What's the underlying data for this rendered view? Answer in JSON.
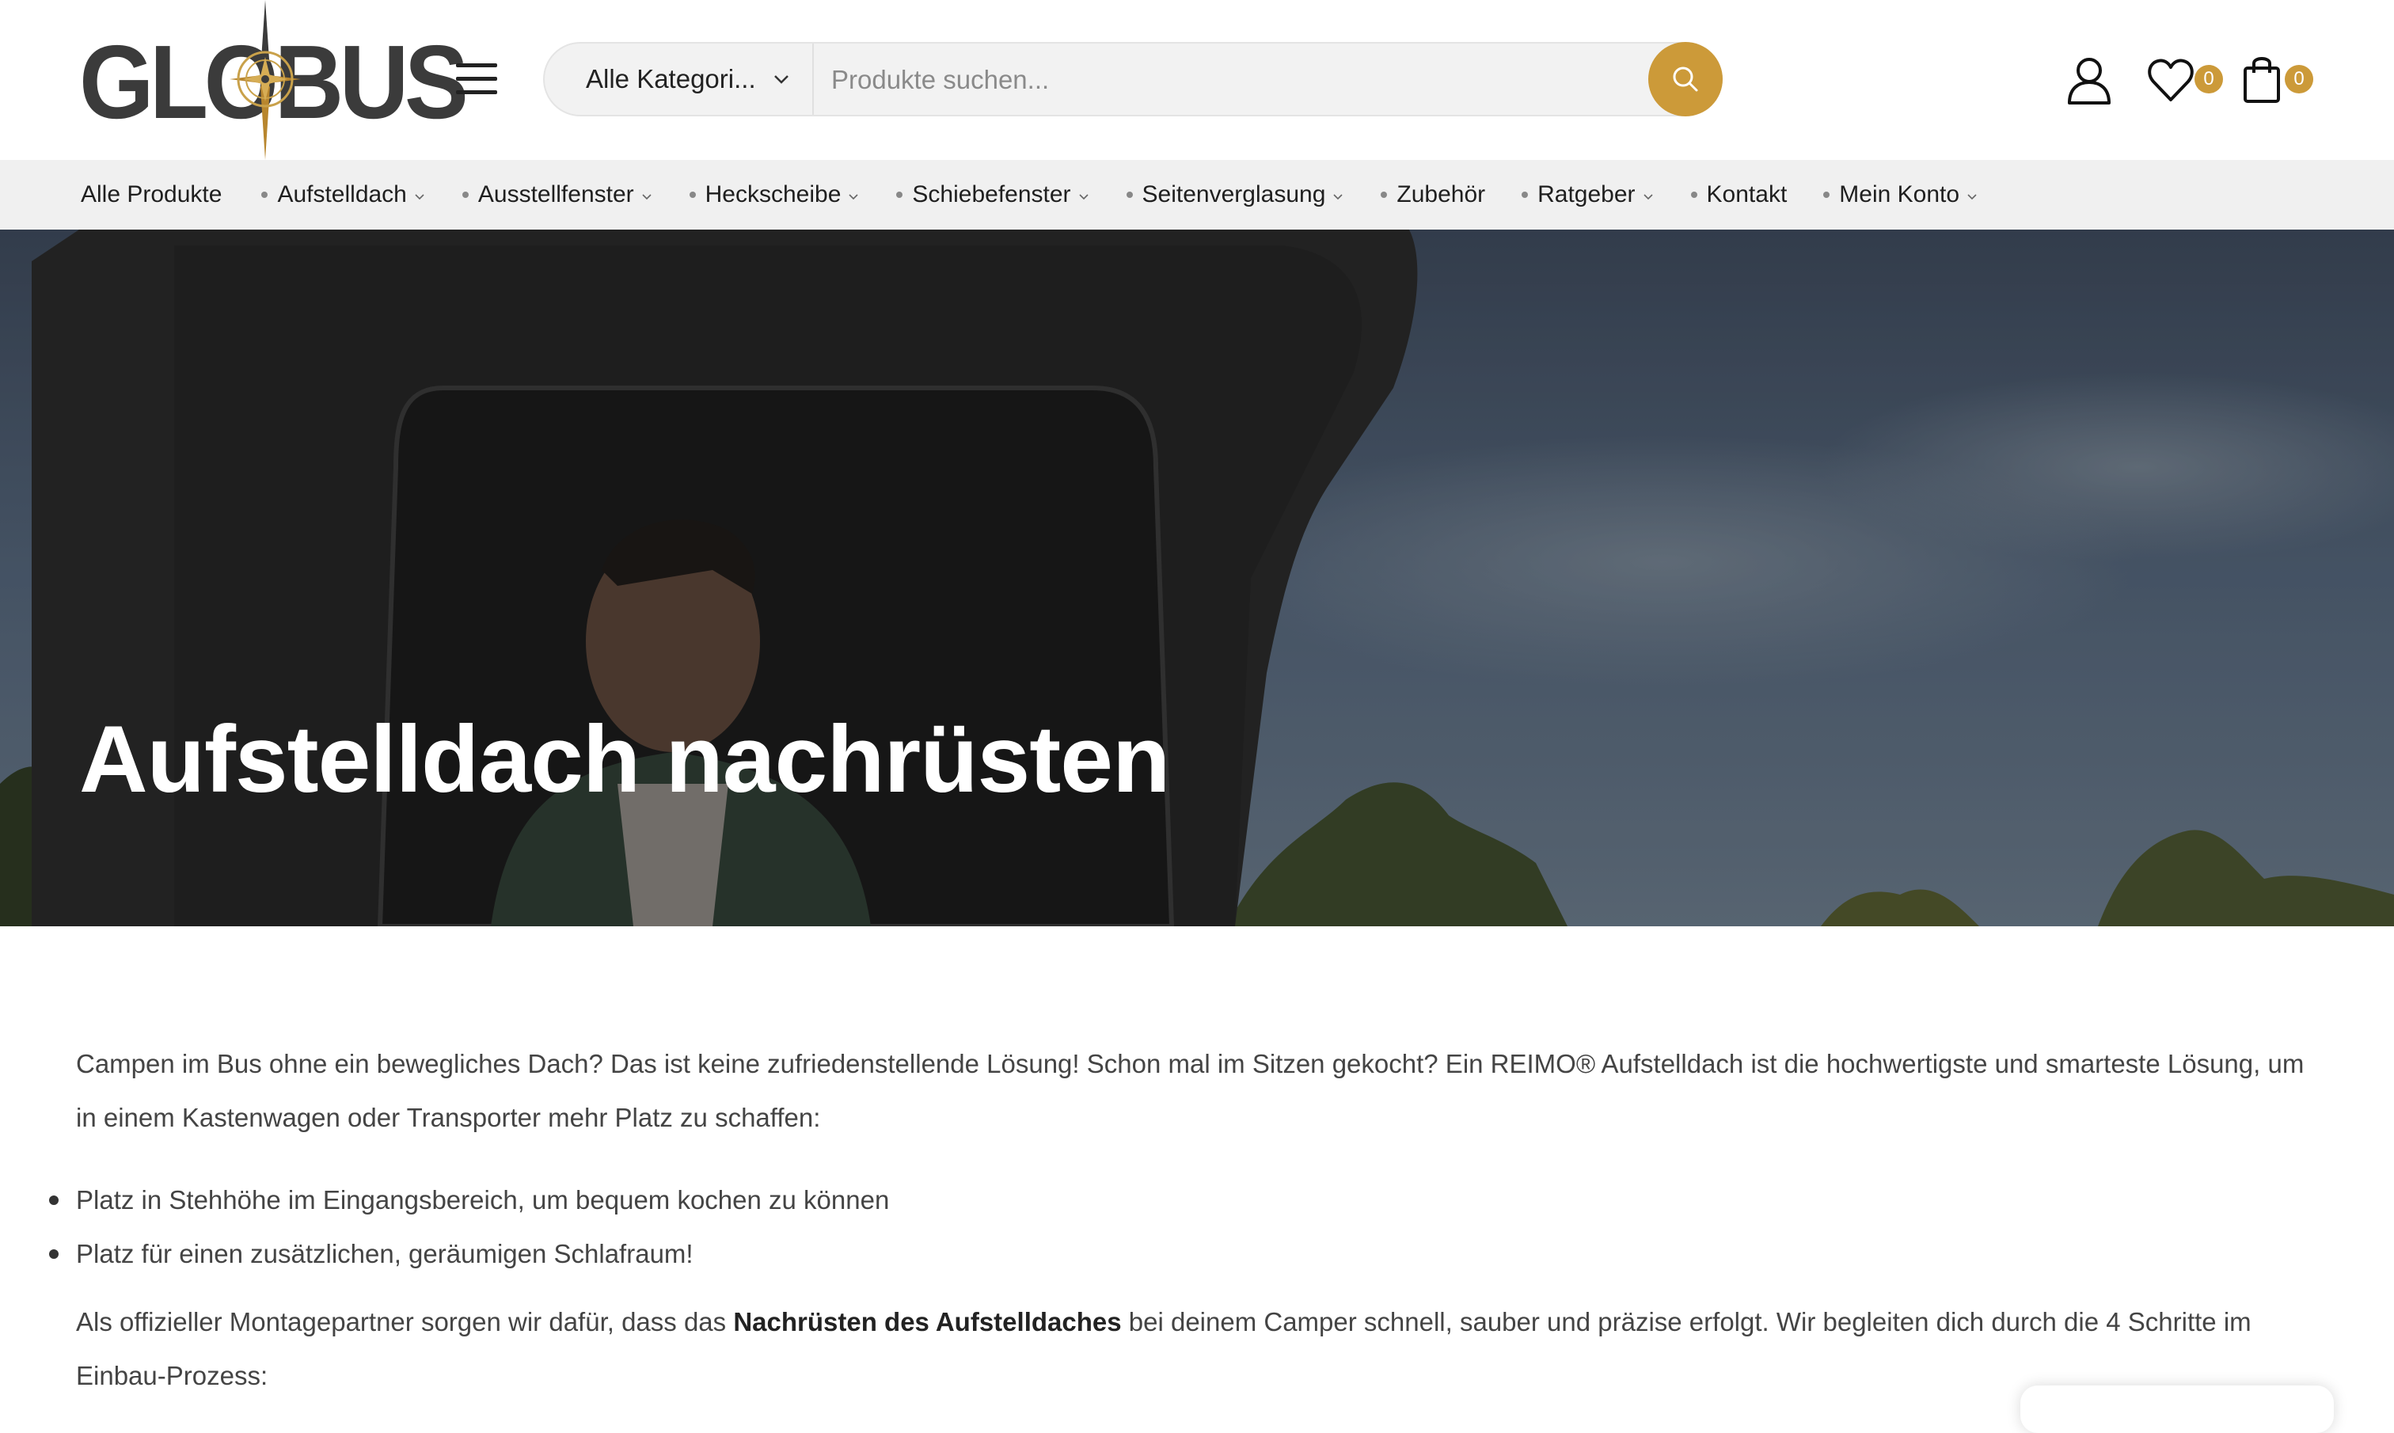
{
  "header": {
    "logo_text": "GLOBUS",
    "search": {
      "category_label": "Alle Kategori...",
      "placeholder": "Produkte suchen..."
    },
    "wishlist_count": "0",
    "cart_count": "0"
  },
  "nav": {
    "items": [
      {
        "label": "Alle Produkte",
        "dropdown": false,
        "dot": false
      },
      {
        "label": "Aufstelldach",
        "dropdown": true,
        "dot": true
      },
      {
        "label": "Ausstellfenster",
        "dropdown": true,
        "dot": true
      },
      {
        "label": "Heckscheibe",
        "dropdown": true,
        "dot": true
      },
      {
        "label": "Schiebefenster",
        "dropdown": true,
        "dot": true
      },
      {
        "label": "Seitenverglasung",
        "dropdown": true,
        "dot": true
      },
      {
        "label": "Zubehör",
        "dropdown": false,
        "dot": true
      },
      {
        "label": "Ratgeber",
        "dropdown": true,
        "dot": true
      },
      {
        "label": "Kontakt",
        "dropdown": false,
        "dot": true
      },
      {
        "label": "Mein Konto",
        "dropdown": true,
        "dot": true
      }
    ]
  },
  "hero": {
    "title": "Aufstelldach nachrüsten"
  },
  "content": {
    "intro": "Campen im Bus ohne ein bewegliches Dach? Das ist keine zufriedenstellende Lösung! Schon mal im Sitzen gekocht? Ein REIMO® Aufstelldach ist die hochwertigste und smarteste Lösung, um in einem Kastenwagen oder Transporter mehr Platz zu schaffen:",
    "bullets": [
      "Platz in Stehhöhe im Eingangsbereich, um bequem kochen zu können",
      "Platz für einen zusätzlichen, geräumigen Schlafraum!"
    ],
    "outro_before": "Als offizieller Montagepartner sorgen wir dafür, dass das ",
    "outro_bold": "Nachrüsten des Aufstelldaches",
    "outro_after": " bei deinem Camper schnell, sauber und präzise erfolgt. Wir begleiten dich durch die 4 Schritte im Einbau-Prozess:"
  },
  "colors": {
    "accent": "#cc9a39",
    "nav_bg": "#f0f0f0",
    "text": "#444444"
  },
  "icons": [
    "menu-icon",
    "chevron-down-icon",
    "search-icon",
    "user-icon",
    "heart-icon",
    "shopping-bag-icon",
    "compass-icon"
  ]
}
